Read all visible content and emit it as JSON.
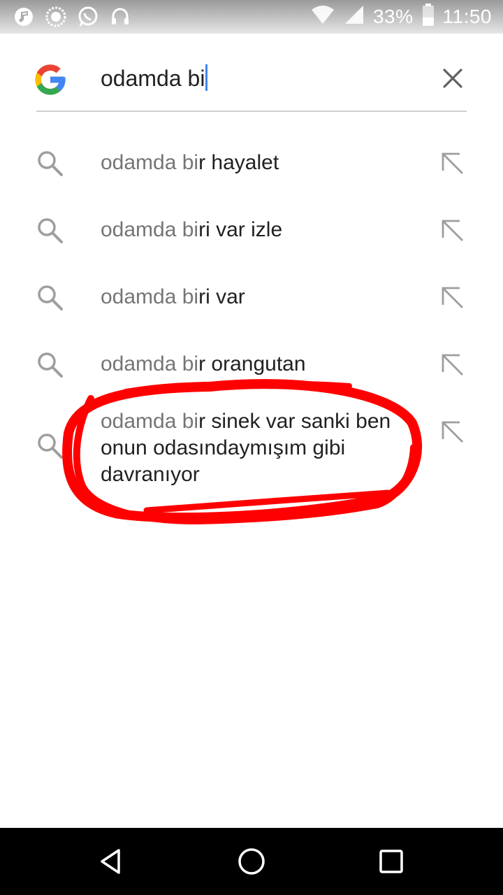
{
  "status_bar": {
    "battery_text": "33%",
    "time": "11:50",
    "icons": [
      "music-icon",
      "sync-icon",
      "whatsapp-icon",
      "headset-icon",
      "wifi-icon",
      "signal-icon",
      "battery-icon"
    ]
  },
  "search": {
    "query_text": "odamda bi",
    "logo": "google-g-logo",
    "clear_icon": "close-icon"
  },
  "suggestions": [
    {
      "prefix": "odamda bi",
      "rest": "r hayalet"
    },
    {
      "prefix": "odamda bi",
      "rest": "ri var izle"
    },
    {
      "prefix": "odamda bi",
      "rest": "ri var"
    },
    {
      "prefix": "odamda bi",
      "rest": "r orangutan"
    },
    {
      "prefix": "odamda bi",
      "rest": "r sinek var sanki ben onun odasındaymışım gibi davranıyor"
    }
  ],
  "annotation": {
    "color": "#ff0000",
    "shape": "hand-drawn-ellipse"
  },
  "colors": {
    "google_blue": "#4285f4",
    "google_red": "#ea4335",
    "google_yellow": "#fbbc05",
    "google_green": "#34a853"
  },
  "nav_bar": {
    "icons": [
      "back-icon",
      "home-icon",
      "recents-icon"
    ]
  }
}
